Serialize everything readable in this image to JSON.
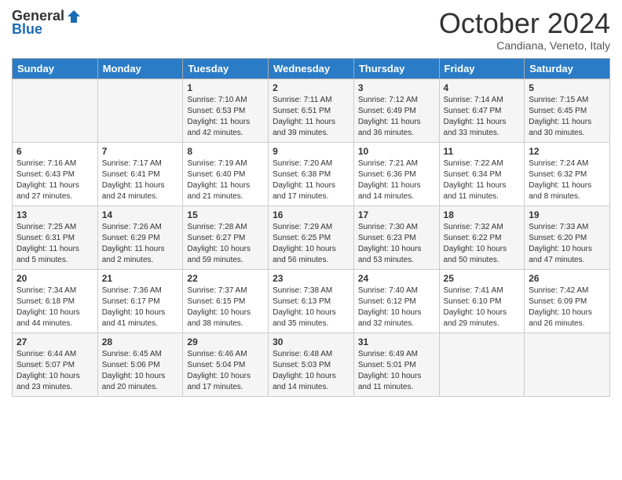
{
  "header": {
    "logo_general": "General",
    "logo_blue": "Blue",
    "month_title": "October 2024",
    "location": "Candiana, Veneto, Italy"
  },
  "days_of_week": [
    "Sunday",
    "Monday",
    "Tuesday",
    "Wednesday",
    "Thursday",
    "Friday",
    "Saturday"
  ],
  "weeks": [
    [
      {
        "day": "",
        "sunrise": "",
        "sunset": "",
        "daylight": ""
      },
      {
        "day": "",
        "sunrise": "",
        "sunset": "",
        "daylight": ""
      },
      {
        "day": "1",
        "sunrise": "Sunrise: 7:10 AM",
        "sunset": "Sunset: 6:53 PM",
        "daylight": "Daylight: 11 hours and 42 minutes."
      },
      {
        "day": "2",
        "sunrise": "Sunrise: 7:11 AM",
        "sunset": "Sunset: 6:51 PM",
        "daylight": "Daylight: 11 hours and 39 minutes."
      },
      {
        "day": "3",
        "sunrise": "Sunrise: 7:12 AM",
        "sunset": "Sunset: 6:49 PM",
        "daylight": "Daylight: 11 hours and 36 minutes."
      },
      {
        "day": "4",
        "sunrise": "Sunrise: 7:14 AM",
        "sunset": "Sunset: 6:47 PM",
        "daylight": "Daylight: 11 hours and 33 minutes."
      },
      {
        "day": "5",
        "sunrise": "Sunrise: 7:15 AM",
        "sunset": "Sunset: 6:45 PM",
        "daylight": "Daylight: 11 hours and 30 minutes."
      }
    ],
    [
      {
        "day": "6",
        "sunrise": "Sunrise: 7:16 AM",
        "sunset": "Sunset: 6:43 PM",
        "daylight": "Daylight: 11 hours and 27 minutes."
      },
      {
        "day": "7",
        "sunrise": "Sunrise: 7:17 AM",
        "sunset": "Sunset: 6:41 PM",
        "daylight": "Daylight: 11 hours and 24 minutes."
      },
      {
        "day": "8",
        "sunrise": "Sunrise: 7:19 AM",
        "sunset": "Sunset: 6:40 PM",
        "daylight": "Daylight: 11 hours and 21 minutes."
      },
      {
        "day": "9",
        "sunrise": "Sunrise: 7:20 AM",
        "sunset": "Sunset: 6:38 PM",
        "daylight": "Daylight: 11 hours and 17 minutes."
      },
      {
        "day": "10",
        "sunrise": "Sunrise: 7:21 AM",
        "sunset": "Sunset: 6:36 PM",
        "daylight": "Daylight: 11 hours and 14 minutes."
      },
      {
        "day": "11",
        "sunrise": "Sunrise: 7:22 AM",
        "sunset": "Sunset: 6:34 PM",
        "daylight": "Daylight: 11 hours and 11 minutes."
      },
      {
        "day": "12",
        "sunrise": "Sunrise: 7:24 AM",
        "sunset": "Sunset: 6:32 PM",
        "daylight": "Daylight: 11 hours and 8 minutes."
      }
    ],
    [
      {
        "day": "13",
        "sunrise": "Sunrise: 7:25 AM",
        "sunset": "Sunset: 6:31 PM",
        "daylight": "Daylight: 11 hours and 5 minutes."
      },
      {
        "day": "14",
        "sunrise": "Sunrise: 7:26 AM",
        "sunset": "Sunset: 6:29 PM",
        "daylight": "Daylight: 11 hours and 2 minutes."
      },
      {
        "day": "15",
        "sunrise": "Sunrise: 7:28 AM",
        "sunset": "Sunset: 6:27 PM",
        "daylight": "Daylight: 10 hours and 59 minutes."
      },
      {
        "day": "16",
        "sunrise": "Sunrise: 7:29 AM",
        "sunset": "Sunset: 6:25 PM",
        "daylight": "Daylight: 10 hours and 56 minutes."
      },
      {
        "day": "17",
        "sunrise": "Sunrise: 7:30 AM",
        "sunset": "Sunset: 6:23 PM",
        "daylight": "Daylight: 10 hours and 53 minutes."
      },
      {
        "day": "18",
        "sunrise": "Sunrise: 7:32 AM",
        "sunset": "Sunset: 6:22 PM",
        "daylight": "Daylight: 10 hours and 50 minutes."
      },
      {
        "day": "19",
        "sunrise": "Sunrise: 7:33 AM",
        "sunset": "Sunset: 6:20 PM",
        "daylight": "Daylight: 10 hours and 47 minutes."
      }
    ],
    [
      {
        "day": "20",
        "sunrise": "Sunrise: 7:34 AM",
        "sunset": "Sunset: 6:18 PM",
        "daylight": "Daylight: 10 hours and 44 minutes."
      },
      {
        "day": "21",
        "sunrise": "Sunrise: 7:36 AM",
        "sunset": "Sunset: 6:17 PM",
        "daylight": "Daylight: 10 hours and 41 minutes."
      },
      {
        "day": "22",
        "sunrise": "Sunrise: 7:37 AM",
        "sunset": "Sunset: 6:15 PM",
        "daylight": "Daylight: 10 hours and 38 minutes."
      },
      {
        "day": "23",
        "sunrise": "Sunrise: 7:38 AM",
        "sunset": "Sunset: 6:13 PM",
        "daylight": "Daylight: 10 hours and 35 minutes."
      },
      {
        "day": "24",
        "sunrise": "Sunrise: 7:40 AM",
        "sunset": "Sunset: 6:12 PM",
        "daylight": "Daylight: 10 hours and 32 minutes."
      },
      {
        "day": "25",
        "sunrise": "Sunrise: 7:41 AM",
        "sunset": "Sunset: 6:10 PM",
        "daylight": "Daylight: 10 hours and 29 minutes."
      },
      {
        "day": "26",
        "sunrise": "Sunrise: 7:42 AM",
        "sunset": "Sunset: 6:09 PM",
        "daylight": "Daylight: 10 hours and 26 minutes."
      }
    ],
    [
      {
        "day": "27",
        "sunrise": "Sunrise: 6:44 AM",
        "sunset": "Sunset: 5:07 PM",
        "daylight": "Daylight: 10 hours and 23 minutes."
      },
      {
        "day": "28",
        "sunrise": "Sunrise: 6:45 AM",
        "sunset": "Sunset: 5:06 PM",
        "daylight": "Daylight: 10 hours and 20 minutes."
      },
      {
        "day": "29",
        "sunrise": "Sunrise: 6:46 AM",
        "sunset": "Sunset: 5:04 PM",
        "daylight": "Daylight: 10 hours and 17 minutes."
      },
      {
        "day": "30",
        "sunrise": "Sunrise: 6:48 AM",
        "sunset": "Sunset: 5:03 PM",
        "daylight": "Daylight: 10 hours and 14 minutes."
      },
      {
        "day": "31",
        "sunrise": "Sunrise: 6:49 AM",
        "sunset": "Sunset: 5:01 PM",
        "daylight": "Daylight: 10 hours and 11 minutes."
      },
      {
        "day": "",
        "sunrise": "",
        "sunset": "",
        "daylight": ""
      },
      {
        "day": "",
        "sunrise": "",
        "sunset": "",
        "daylight": ""
      }
    ]
  ]
}
